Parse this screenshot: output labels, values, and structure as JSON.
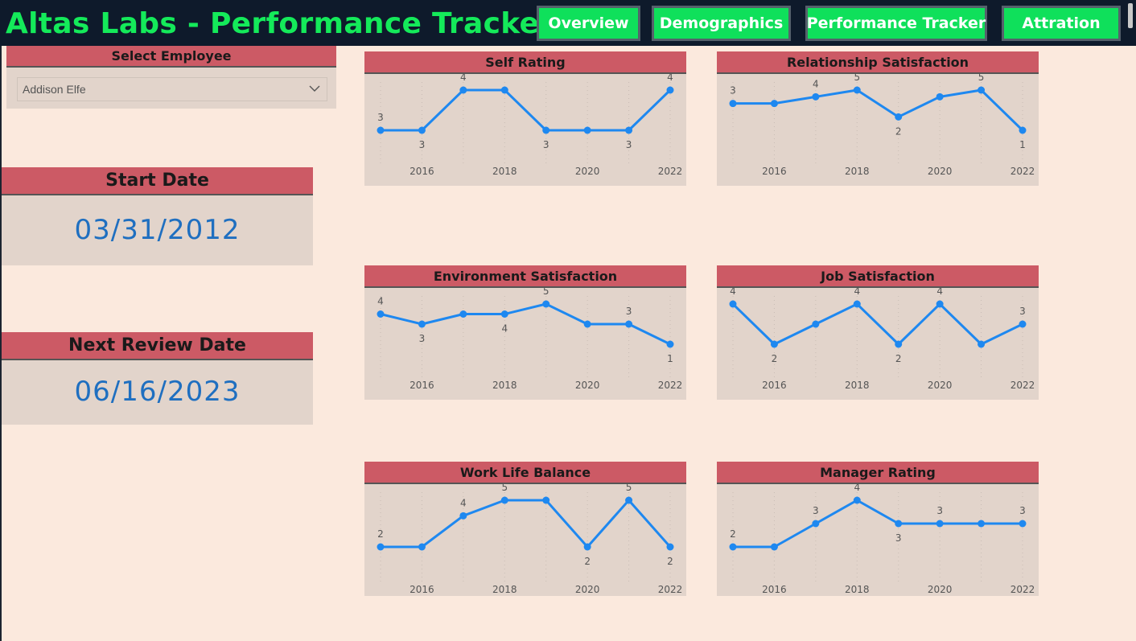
{
  "header": {
    "title": "Altas Labs - Performance Tracker",
    "nav": [
      {
        "label": "Overview"
      },
      {
        "label": "Demographics"
      },
      {
        "label": "Performance Tracker"
      },
      {
        "label": "Attration"
      }
    ]
  },
  "slicer": {
    "title": "Select Employee",
    "selected": "Addison Elfe"
  },
  "kpis": {
    "start_date": {
      "title": "Start Date",
      "value": "03/31/2012"
    },
    "next_review": {
      "title": "Next Review Date",
      "value": "06/16/2023"
    }
  },
  "colors": {
    "line": "#1e88f0",
    "header_bar": "#cc5a65",
    "card_bg": "#e2d4cb",
    "page_bg": "#fbe9dd",
    "title_green": "#14ea5a"
  },
  "chart_data": [
    {
      "type": "line",
      "title": "Self Rating",
      "x": [
        2015,
        2016,
        2017,
        2018,
        2019,
        2020,
        2021,
        2022
      ],
      "values": [
        3,
        3,
        4,
        4,
        3,
        3,
        3,
        4
      ],
      "xticks": [
        2016,
        2018,
        2020,
        2022
      ],
      "labels": [
        {
          "x": 2015,
          "text": "3"
        },
        {
          "x": 2016,
          "text": "3"
        },
        {
          "x": 2017,
          "text": "4"
        },
        {
          "x": 2019,
          "text": "3"
        },
        {
          "x": 2021,
          "text": "3"
        },
        {
          "x": 2022,
          "text": "4"
        }
      ]
    },
    {
      "type": "line",
      "title": "Relationship Satisfaction",
      "x": [
        2015,
        2016,
        2017,
        2018,
        2019,
        2020,
        2021,
        2022
      ],
      "values": [
        3,
        3,
        3.5,
        4,
        2,
        3.5,
        4,
        1
      ],
      "xticks": [
        2016,
        2018,
        2020,
        2022
      ],
      "labels": [
        {
          "x": 2015,
          "text": "3"
        },
        {
          "x": 2017,
          "text": "4"
        },
        {
          "x": 2018,
          "text": "5"
        },
        {
          "x": 2019,
          "text": "2"
        },
        {
          "x": 2021,
          "text": "5"
        },
        {
          "x": 2022,
          "text": "1"
        }
      ]
    },
    {
      "type": "line",
      "title": "Environment Satisfaction",
      "x": [
        2015,
        2016,
        2017,
        2018,
        2019,
        2020,
        2021,
        2022
      ],
      "values": [
        4,
        3,
        4,
        4,
        5,
        3,
        3,
        1
      ],
      "xticks": [
        2016,
        2018,
        2020,
        2022
      ],
      "labels": [
        {
          "x": 2015,
          "text": "4"
        },
        {
          "x": 2016,
          "text": "3"
        },
        {
          "x": 2018,
          "text": "4"
        },
        {
          "x": 2019,
          "text": "5"
        },
        {
          "x": 2021,
          "text": "3"
        },
        {
          "x": 2022,
          "text": "1"
        }
      ]
    },
    {
      "type": "line",
      "title": "Job Satisfaction",
      "x": [
        2015,
        2016,
        2017,
        2018,
        2019,
        2020,
        2021,
        2022
      ],
      "values": [
        5,
        3,
        4,
        5,
        3,
        5,
        3,
        4
      ],
      "xticks": [
        2016,
        2018,
        2020,
        2022
      ],
      "labels": [
        {
          "x": 2015,
          "text": "4"
        },
        {
          "x": 2016,
          "text": "2"
        },
        {
          "x": 2018,
          "text": "4"
        },
        {
          "x": 2019,
          "text": "2"
        },
        {
          "x": 2020,
          "text": "4"
        },
        {
          "x": 2022,
          "text": "3"
        }
      ]
    },
    {
      "type": "line",
      "title": "Work Life Balance",
      "x": [
        2015,
        2016,
        2017,
        2018,
        2019,
        2020,
        2021,
        2022
      ],
      "values": [
        2,
        2,
        4,
        5,
        5,
        2,
        5,
        2
      ],
      "xticks": [
        2016,
        2018,
        2020,
        2022
      ],
      "labels": [
        {
          "x": 2015,
          "text": "2"
        },
        {
          "x": 2017,
          "text": "4"
        },
        {
          "x": 2018,
          "text": "5"
        },
        {
          "x": 2020,
          "text": "2"
        },
        {
          "x": 2021,
          "text": "5"
        },
        {
          "x": 2022,
          "text": "2"
        }
      ]
    },
    {
      "type": "line",
      "title": "Manager Rating",
      "x": [
        2015,
        2016,
        2017,
        2018,
        2019,
        2020,
        2021,
        2022
      ],
      "values": [
        2,
        2,
        3,
        4,
        3,
        3,
        3,
        3
      ],
      "xticks": [
        2016,
        2018,
        2020,
        2022
      ],
      "labels": [
        {
          "x": 2015,
          "text": "2"
        },
        {
          "x": 2017,
          "text": "3"
        },
        {
          "x": 2018,
          "text": "4"
        },
        {
          "x": 2019,
          "text": "3"
        },
        {
          "x": 2020,
          "text": "3"
        },
        {
          "x": 2022,
          "text": "3"
        }
      ]
    }
  ]
}
